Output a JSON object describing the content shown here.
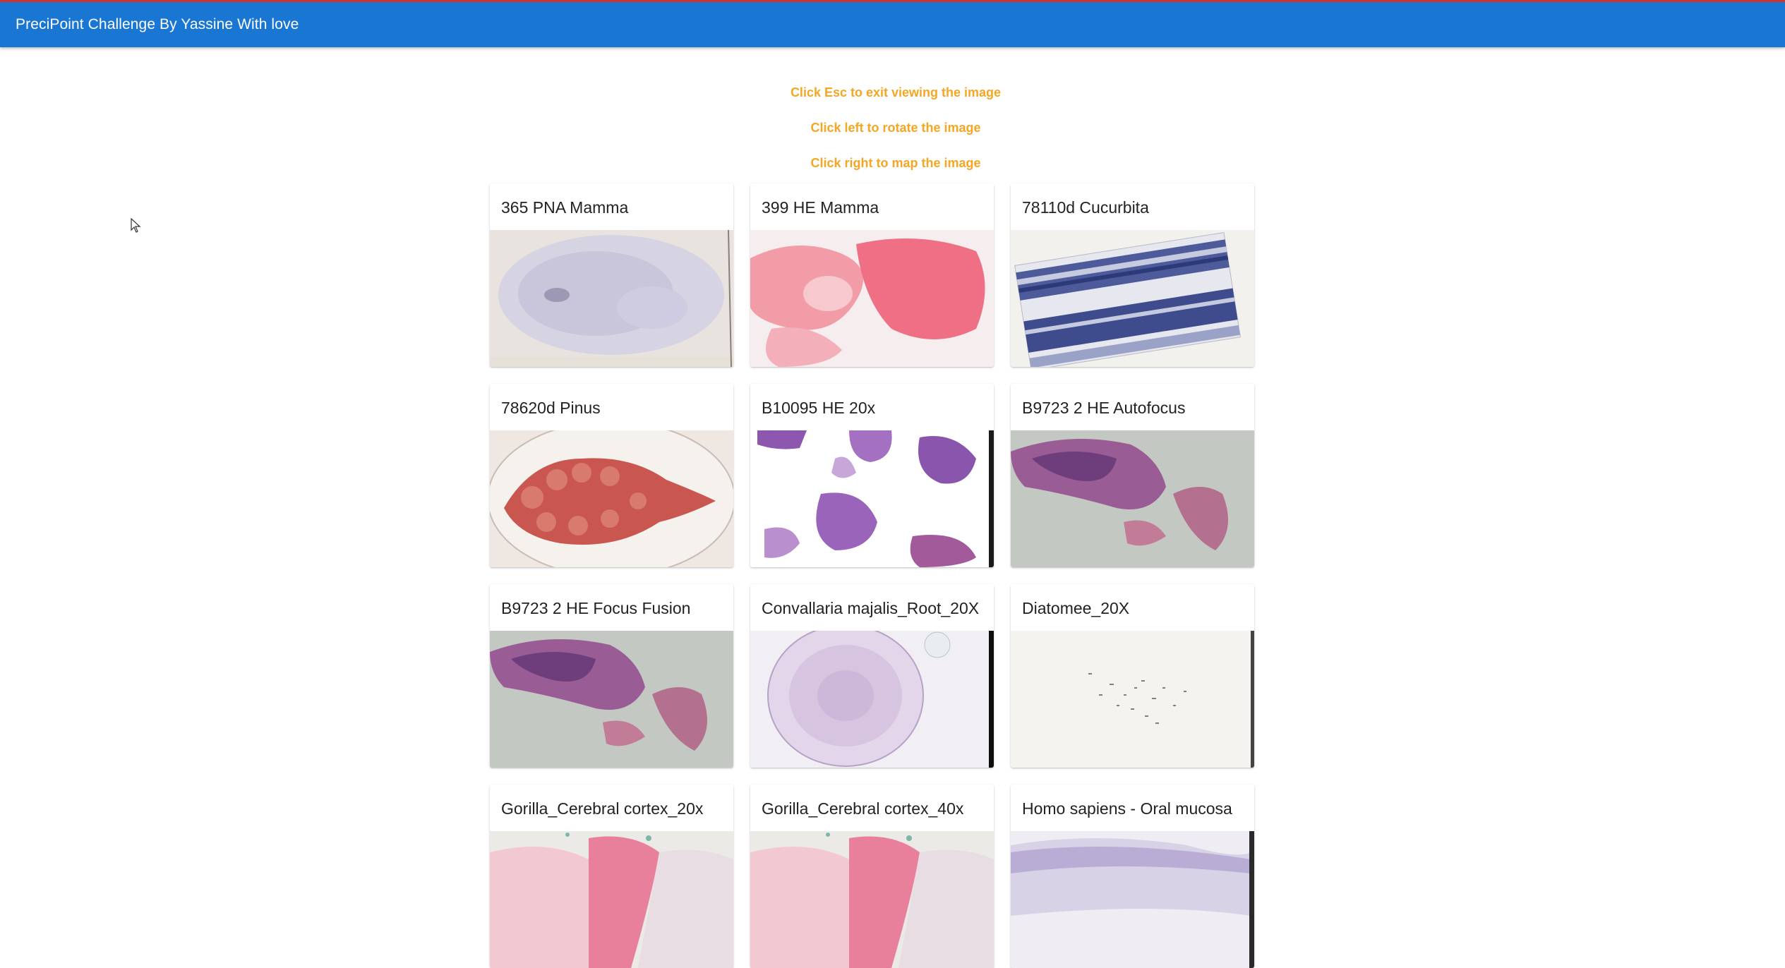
{
  "appbar": {
    "title": "PreciPoint Challenge By Yassine With love"
  },
  "instructions": [
    "Click Esc to exit viewing the image",
    "Click left to rotate the image",
    "Click right to map the image"
  ],
  "cards": [
    {
      "title": "365 PNA Mamma",
      "image": "pale-blue-tissue-slide"
    },
    {
      "title": "399 HE Mamma",
      "image": "pink-tissue-slide"
    },
    {
      "title": "78110d Cucurbita",
      "image": "blue-striped-tissue-slide"
    },
    {
      "title": "78620d Pinus",
      "image": "red-pinus-needle-slide"
    },
    {
      "title": "B10095 HE 20x",
      "image": "purple-scattered-tissue-slide"
    },
    {
      "title": "B9723 2 HE Autofocus",
      "image": "purple-pink-tissue-slide"
    },
    {
      "title": "B9723 2 HE Focus Fusion",
      "image": "purple-pink-tissue-slide"
    },
    {
      "title": "Convallaria majalis_Root_20X",
      "image": "round-root-section-slide"
    },
    {
      "title": "Diatomee_20X",
      "image": "sparse-diatom-slide"
    },
    {
      "title": "Gorilla_Cerebral cortex_20x",
      "image": "pink-cortex-slide"
    },
    {
      "title": "Gorilla_Cerebral cortex_40x",
      "image": "pink-cortex-slide"
    },
    {
      "title": "Homo sapiens - Oral mucosa",
      "image": "pale-purple-mucosa-slide"
    }
  ],
  "colors": {
    "appbar": "#1976d2",
    "appbar_border": "#d32f2f",
    "instruction": "#f5a623"
  }
}
